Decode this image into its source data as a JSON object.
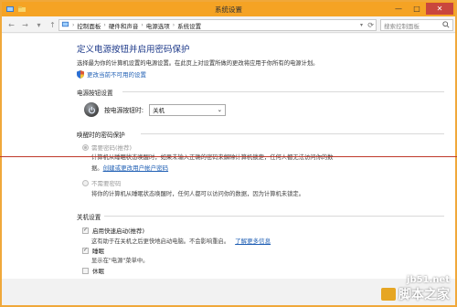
{
  "window": {
    "title": "系统设置"
  },
  "titlebar": {
    "minimize": "—",
    "maximize": "□",
    "close": "✕"
  },
  "address": {
    "crumbs": [
      "控制面板",
      "硬件和声音",
      "电源选项",
      "系统设置"
    ],
    "search_placeholder": "搜索控制面板"
  },
  "main": {
    "heading": "定义电源按钮并启用密码保护",
    "description": "选择最为你的计算机设置的电源设置。在此页上对设置所做的更改将应用于你所有的电源计划。",
    "change_link": "更改当前不可用的设置"
  },
  "power_button": {
    "section_title": "电源按钮设置",
    "label": "按电源按钮时:",
    "selected_option": "关机"
  },
  "wake_password": {
    "section_title": "唤醒时的密码保护",
    "require_label": "需要密码(推荐)",
    "require_desc_1": "计算机从睡眠状态唤醒时，如果未输入正确的密码来解除计算机锁定，任何人都无法访问你的数",
    "require_desc_2_prefix": "据。",
    "require_link": "创建或更改用户帐户密码",
    "no_require_label": "不需要密码",
    "no_require_desc": "将你的计算机从睡眠状态唤醒时，任何人都可以访问你的数据，因为计算机未锁定。"
  },
  "shutdown": {
    "section_title": "关机设置",
    "fast_startup_label": "启用快速启动(推荐)",
    "fast_startup_desc": "这有助于在关机之后更快地启动电脑。不会影响重启。",
    "learn_more": "了解更多信息",
    "sleep_label": "睡眠",
    "sleep_desc": "显示在\"电源\"菜单中。",
    "hibernate_label": "休眠"
  },
  "watermark": {
    "site": "jb51.net",
    "brand": "脚本之家"
  },
  "colors": {
    "titlebar": "#f5a324",
    "heading": "#1e3a8a",
    "link": "#1f5fb4",
    "redline": "#c0392b"
  }
}
